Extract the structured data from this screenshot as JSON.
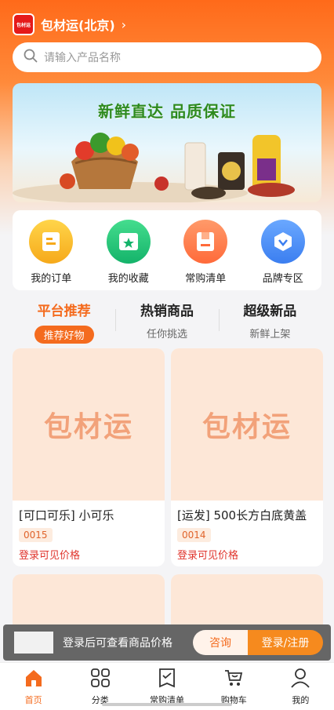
{
  "header": {
    "logo_text": "包材运",
    "city": "包材运(北京)",
    "chevron": "›"
  },
  "search": {
    "placeholder": "请输入产品名称"
  },
  "banner": {
    "title": "新鲜直达 品质保证"
  },
  "quick_links": [
    {
      "label": "我的订单",
      "icon": "order-icon",
      "color": "#fbbf1a"
    },
    {
      "label": "我的收藏",
      "icon": "favorites-icon",
      "color": "#20c277"
    },
    {
      "label": "常购清单",
      "icon": "frequent-list-icon",
      "color": "#ff7a45"
    },
    {
      "label": "品牌专区",
      "icon": "brand-icon",
      "color": "#4a8cf0"
    }
  ],
  "tabs": [
    {
      "title": "平台推荐",
      "sub": "推荐好物",
      "active": true
    },
    {
      "title": "热销商品",
      "sub": "任你挑选",
      "active": false
    },
    {
      "title": "超级新品",
      "sub": "新鲜上架",
      "active": false
    }
  ],
  "products": [
    {
      "placeholder": "包材运",
      "name": "[可口可乐] 小可乐",
      "code": "0015",
      "price": "登录可见价格"
    },
    {
      "placeholder": "包材运",
      "name": "[运发] 500长方白底黄盖",
      "code": "0014",
      "price": "登录可见价格"
    }
  ],
  "login_bar": {
    "text": "登录后可查看商品价格",
    "consult": "咨询",
    "login": "登录/注册"
  },
  "tabbar": [
    {
      "label": "首页",
      "icon": "home-icon",
      "active": true
    },
    {
      "label": "分类",
      "icon": "category-icon",
      "active": false
    },
    {
      "label": "常购清单",
      "icon": "list-icon",
      "active": false
    },
    {
      "label": "购物车",
      "icon": "cart-icon",
      "active": false
    },
    {
      "label": "我的",
      "icon": "profile-icon",
      "active": false
    }
  ],
  "colors": {
    "accent": "#f46b1e",
    "price": "#e0342c"
  }
}
